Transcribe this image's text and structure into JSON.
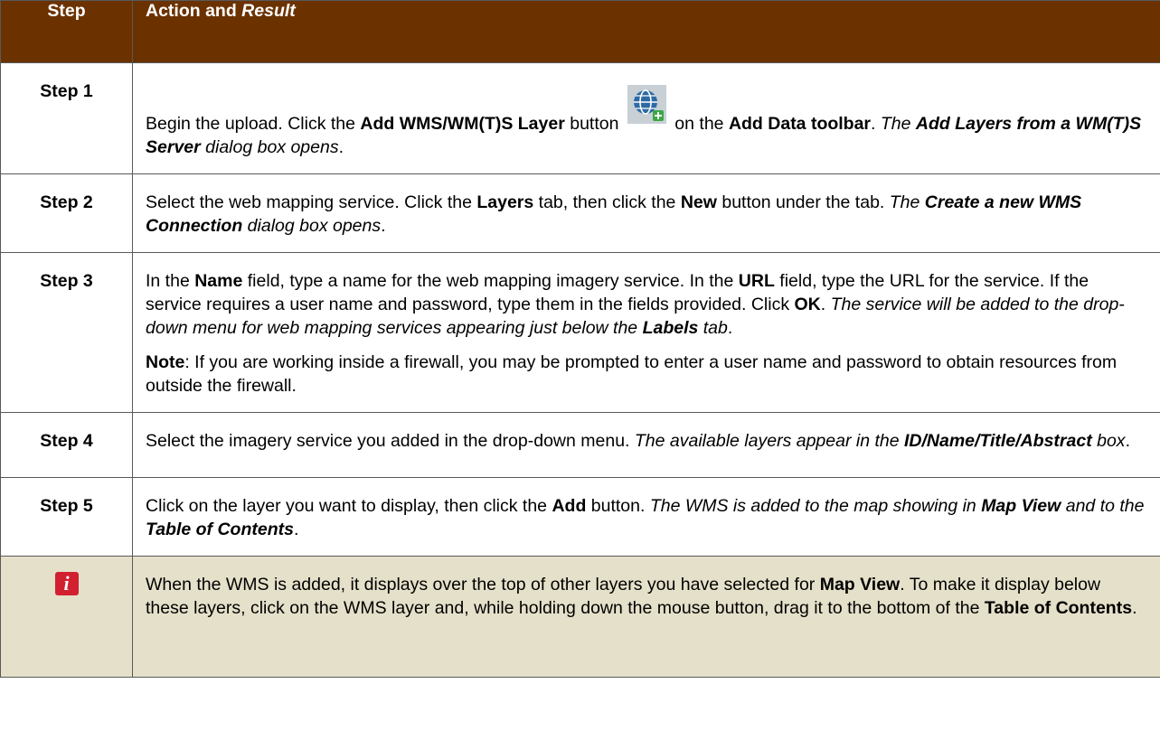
{
  "header": {
    "step": "Step",
    "action": "Action and ",
    "result": "Result"
  },
  "rows": [
    {
      "step": "Step 1",
      "paragraphs": [
        [
          {
            "t": "Begin the upload. Click the "
          },
          {
            "t": "Add WMS/WM(T)S Layer",
            "b": true
          },
          {
            "t": " button "
          },
          {
            "icon": "add-wms-layer-icon"
          },
          {
            "t": " on the "
          },
          {
            "t": "Add Data toolbar",
            "b": true
          },
          {
            "t": ". "
          },
          {
            "t": "The ",
            "i": true
          },
          {
            "t": "Add Layers from a WM(T)S Server",
            "b": true,
            "i": true
          },
          {
            "t": " dialog box opens",
            "i": true
          },
          {
            "t": "."
          }
        ]
      ]
    },
    {
      "step": "Step 2",
      "paragraphs": [
        [
          {
            "t": "Select the web mapping service. Click the "
          },
          {
            "t": "Layers",
            "b": true
          },
          {
            "t": " tab, then click the "
          },
          {
            "t": "New",
            "b": true
          },
          {
            "t": " button under the tab. "
          },
          {
            "t": "The ",
            "i": true
          },
          {
            "t": "Create a new WMS Connection",
            "b": true,
            "i": true
          },
          {
            "t": " dialog box opens",
            "i": true
          },
          {
            "t": "."
          }
        ]
      ]
    },
    {
      "step": "Step 3",
      "paragraphs": [
        [
          {
            "t": "In the "
          },
          {
            "t": "Name",
            "b": true
          },
          {
            "t": " field, type a name for the web mapping imagery service. In the "
          },
          {
            "t": "URL",
            "b": true
          },
          {
            "t": " field, type the URL for the service. If the service requires a user name and password, type them in the fields provided. Click "
          },
          {
            "t": "OK",
            "b": true
          },
          {
            "t": ". "
          },
          {
            "t": "The service will be added to the drop-down menu for web mapping services appearing just below the ",
            "i": true
          },
          {
            "t": "Labels",
            "b": true,
            "i": true
          },
          {
            "t": " tab",
            "i": true
          },
          {
            "t": "."
          }
        ],
        [
          {
            "t": "Note",
            "b": true
          },
          {
            "t": ": If you are working inside a firewall, you may be prompted to enter a user name and password to obtain resources from outside the firewall."
          }
        ]
      ]
    },
    {
      "step": "Step 4",
      "paragraphs": [
        [
          {
            "t": "Select the imagery service you added in the drop-down menu. "
          },
          {
            "t": "The available layers appear in the ",
            "i": true
          },
          {
            "t": "ID/Name/Title/Abstract",
            "b": true,
            "i": true
          },
          {
            "t": " box",
            "i": true
          },
          {
            "t": "."
          }
        ]
      ]
    },
    {
      "step": "Step 5",
      "paragraphs": [
        [
          {
            "t": "Click on the layer you want to display, then click the "
          },
          {
            "t": "Add",
            "b": true
          },
          {
            "t": " button. "
          },
          {
            "t": "The WMS is added to the map showing in ",
            "i": true
          },
          {
            "t": "Map View",
            "b": true,
            "i": true
          },
          {
            "t": " and to the ",
            "i": true
          },
          {
            "t": "Table of Contents",
            "b": true,
            "i": true
          },
          {
            "t": "."
          }
        ]
      ]
    }
  ],
  "note": {
    "icon": "info-icon",
    "icon_glyph": "i",
    "paragraphs": [
      [
        {
          "t": "When the WMS is added, it displays over the top of other layers you have selected for "
        },
        {
          "t": "Map View",
          "b": true
        },
        {
          "t": ". To make it display below these layers, click on the WMS layer and, while holding down the mouse button, drag it to the bottom of the "
        },
        {
          "t": "Table of Contents",
          "b": true
        },
        {
          "t": "."
        }
      ]
    ]
  },
  "colors": {
    "header_bg": "#6b3200",
    "note_bg": "#e5e0c9",
    "info_icon": "#d1202f"
  }
}
